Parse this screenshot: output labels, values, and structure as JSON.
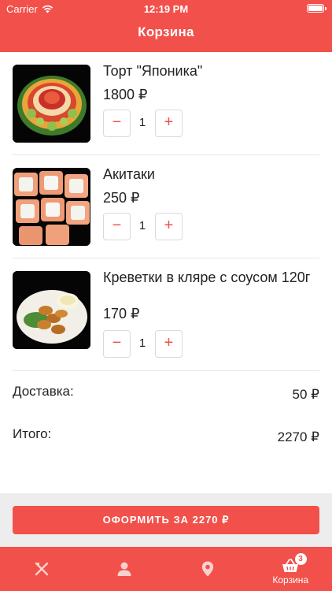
{
  "status_bar": {
    "carrier": "Carrier",
    "time": "12:19 PM"
  },
  "header": {
    "title": "Корзина"
  },
  "cart": {
    "items": [
      {
        "name": "Торт \"Японика\"",
        "price": "1800 ₽",
        "quantity": "1",
        "image": "japanese-cake-roll-image"
      },
      {
        "name": "Акитаки",
        "price": "250 ₽",
        "quantity": "1",
        "image": "akitaki-rolls-image"
      },
      {
        "name": "Креветки в кляре с соусом 120г",
        "price": "170 ₽",
        "quantity": "1",
        "image": "battered-shrimp-image"
      }
    ],
    "decrement_symbol": "−",
    "increment_symbol": "+"
  },
  "summary": {
    "delivery_label": "Доставка:",
    "delivery_value": "50 ₽",
    "total_label": "Итого:",
    "total_value": "2270 ₽"
  },
  "checkout": {
    "label": "ОФОРМИТЬ ЗА 2270 ₽"
  },
  "tabbar": {
    "tabs": [
      {
        "icon": "fork-knife-icon",
        "label": ""
      },
      {
        "icon": "person-icon",
        "label": ""
      },
      {
        "icon": "location-pin-icon",
        "label": ""
      },
      {
        "icon": "basket-icon",
        "label": "Корзина",
        "badge": "3"
      }
    ]
  },
  "colors": {
    "accent": "#f2504a",
    "background": "#ffffff",
    "footer": "#ededed"
  }
}
